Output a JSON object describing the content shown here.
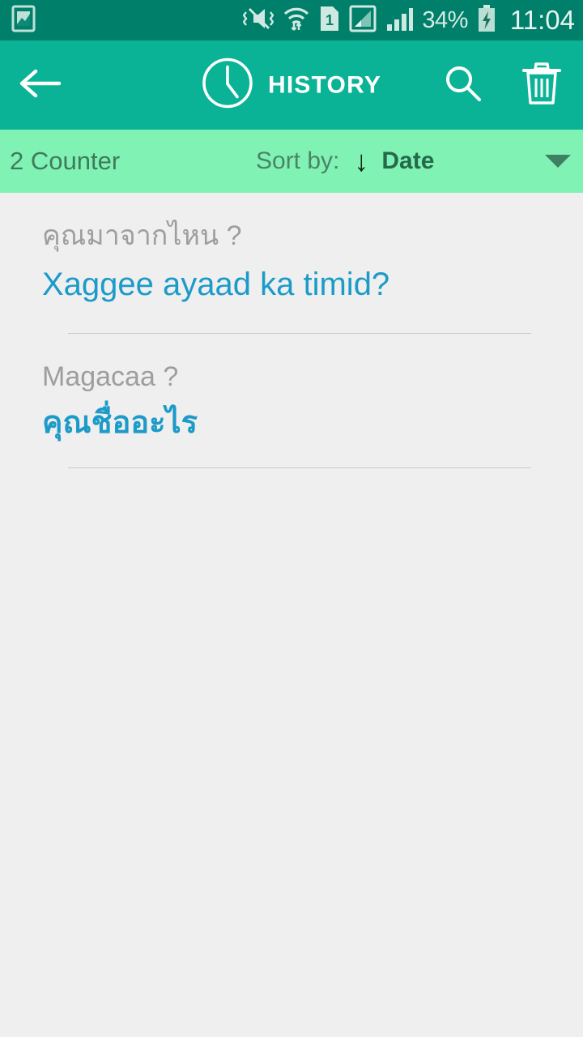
{
  "status_bar": {
    "icons": [
      "screenshot-image-icon",
      "mute-vibrate-icon",
      "wifi-icon",
      "sim-1-icon",
      "signal-sim-icon",
      "signal-bars-icon"
    ],
    "sim_label": "1",
    "battery_percent": "34%",
    "battery_state": "charging",
    "clock": "11:04",
    "background_color": "#00806a"
  },
  "app_bar": {
    "back_label": "back-arrow",
    "title": "HISTORY",
    "clock_icon": "clock-icon",
    "search_label": "search-icon",
    "delete_label": "trash-icon",
    "background_color": "#0bb396"
  },
  "sort_bar": {
    "counter": "2 Counter",
    "sort_by_label": "Sort by:",
    "sort_direction": "↓",
    "sort_value": "Date",
    "caret": "chevron-down-icon",
    "background_color": "#80f2b4"
  },
  "history": {
    "items": [
      {
        "source_text": "คุณมาจากไหน ?",
        "target_text": "Xaggee ayaad ka timid?",
        "target_is_thai": false
      },
      {
        "source_text": "Magacaa ?",
        "target_text": "คุณชื่ออะไร",
        "target_is_thai": true
      }
    ],
    "source_color": "#9e9e9e",
    "target_color": "#1c9bc9",
    "background_color": "#efefef"
  }
}
